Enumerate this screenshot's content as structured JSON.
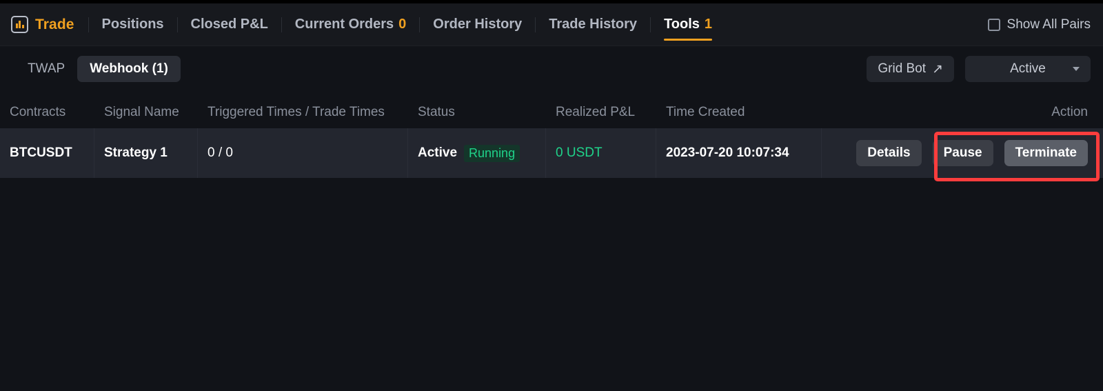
{
  "nav": {
    "brand": {
      "icon": "bar-chart-icon",
      "label": "Trade"
    },
    "items": [
      {
        "label": "Positions",
        "count": "",
        "active": false
      },
      {
        "label": "Closed P&L",
        "count": "",
        "active": false
      },
      {
        "label": "Current Orders",
        "count": "0",
        "active": false
      },
      {
        "label": "Order History",
        "count": "",
        "active": false
      },
      {
        "label": "Trade History",
        "count": "",
        "active": false
      },
      {
        "label": "Tools",
        "count": "1",
        "active": true
      }
    ],
    "show_all_pairs": {
      "label": "Show All Pairs",
      "checked": false
    }
  },
  "toolbar": {
    "tabs": [
      {
        "label": "TWAP",
        "selected": false
      },
      {
        "label": "Webhook (1)",
        "selected": true
      }
    ],
    "grid_bot": {
      "label": "Grid Bot",
      "icon": "external-link-arrow-icon"
    },
    "status_filter": {
      "value": "Active",
      "icon": "chevron-down-icon"
    }
  },
  "table": {
    "columns": [
      "Contracts",
      "Signal Name",
      "Triggered Times / Trade Times",
      "Status",
      "Realized P&L",
      "Time Created",
      "Action"
    ],
    "rows": [
      {
        "contracts": "BTCUSDT",
        "signal_name": "Strategy 1",
        "triggered_times": "0 / 0",
        "status": "Active",
        "status_badge": "Running",
        "realized_pnl": "0 USDT",
        "time_created": "2023-07-20 10:07:34",
        "actions": {
          "details": "Details",
          "pause": "Pause",
          "terminate": "Terminate"
        }
      }
    ]
  },
  "colors": {
    "accent_orange": "#f0a020",
    "status_green": "#1fd38a",
    "highlight_red": "#fc3d3d",
    "page_bg": "#111318",
    "nav_bg": "#17191e",
    "row_bg": "#23262f"
  }
}
